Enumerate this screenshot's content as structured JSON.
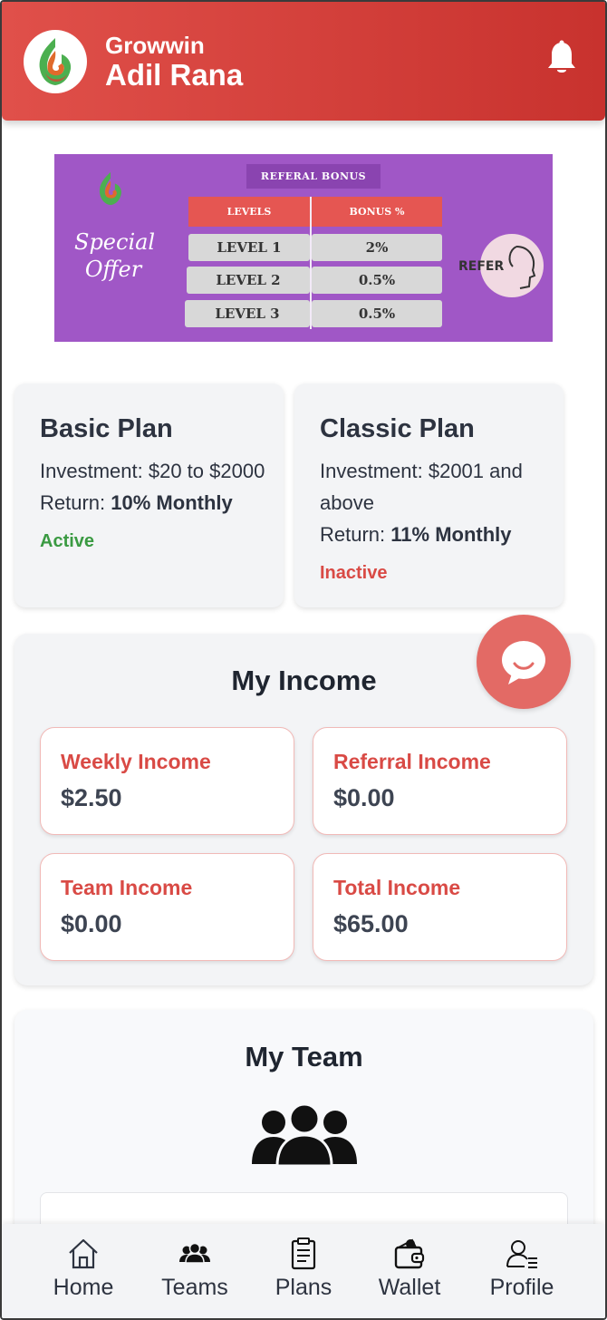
{
  "header": {
    "app_name": "Growwin",
    "user_name": "Adil Rana",
    "notification_icon": "bell-icon"
  },
  "banner": {
    "title": "REFERAL BONUS",
    "special": "Special Offer",
    "col_levels": "LEVELS",
    "col_bonus": "BONUS %",
    "rows": [
      {
        "level": "LEVEL 1",
        "bonus": "2%"
      },
      {
        "level": "LEVEL 2",
        "bonus": "0.5%"
      },
      {
        "level": "LEVEL 3",
        "bonus": "0.5%"
      }
    ],
    "refer": "REFER"
  },
  "plans": [
    {
      "name": "Basic Plan",
      "investment_label": "Investment:",
      "investment": "$20 to $2000",
      "return_label": "Return:",
      "return": "10% Monthly",
      "status": "Active",
      "status_color": "#3a9a42"
    },
    {
      "name": "Classic Plan",
      "investment_label": "Investment:",
      "investment": "$2001 and above",
      "return_label": "Return:",
      "return": "11% Monthly",
      "status": "Inactive",
      "status_color": "#d94a45"
    }
  ],
  "income": {
    "title": "My Income",
    "cards": [
      {
        "label": "Weekly Income",
        "value": "$2.50"
      },
      {
        "label": "Referral Income",
        "value": "$0.00"
      },
      {
        "label": "Team Income",
        "value": "$0.00"
      },
      {
        "label": "Total Income",
        "value": "$65.00"
      }
    ]
  },
  "team": {
    "title": "My Team",
    "icon": "team-icon"
  },
  "chat": {
    "icon": "chat-icon"
  },
  "nav": [
    {
      "label": "Home",
      "icon": "home-icon"
    },
    {
      "label": "Teams",
      "icon": "teams-icon"
    },
    {
      "label": "Plans",
      "icon": "plans-icon"
    },
    {
      "label": "Wallet",
      "icon": "wallet-icon"
    },
    {
      "label": "Profile",
      "icon": "profile-icon"
    }
  ],
  "colors": {
    "brand_red": "#d9433f",
    "income_label": "#d94a45",
    "active": "#3a9a42",
    "inactive": "#d94a45",
    "banner_purple": "#a057c6"
  }
}
